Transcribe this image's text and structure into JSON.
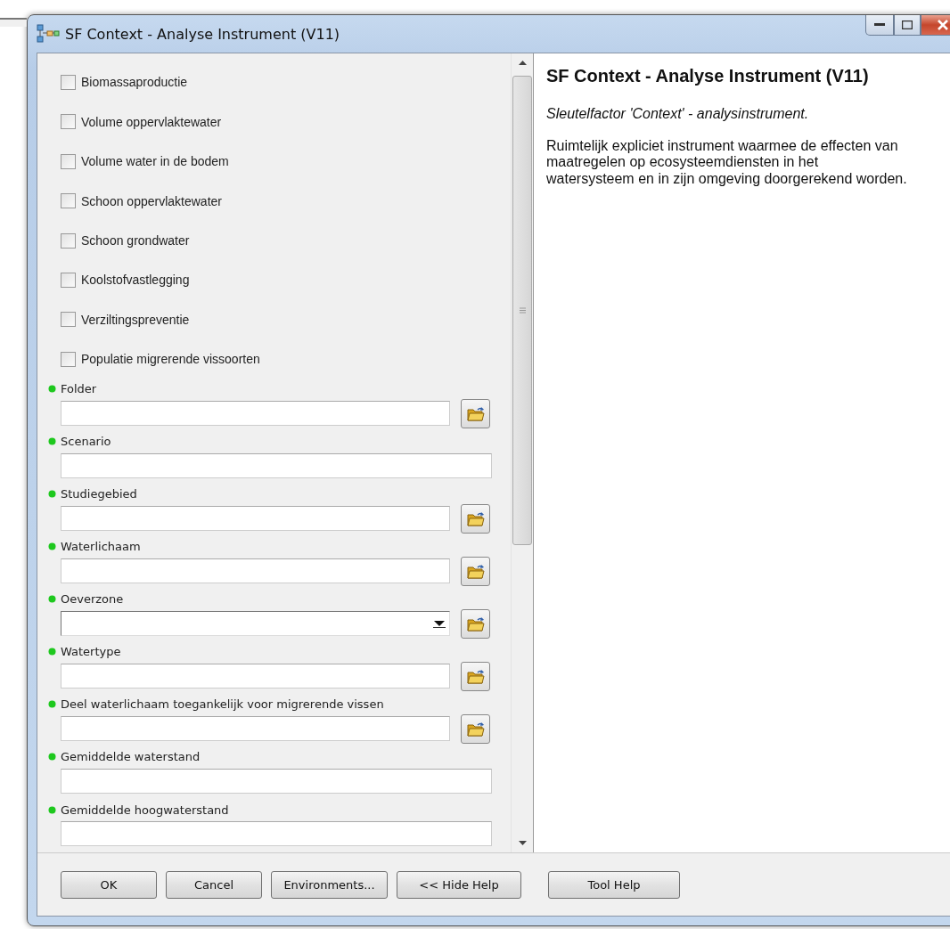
{
  "window": {
    "title": "SF Context - Analyse Instrument (V11)"
  },
  "parameters": [
    {
      "kind": "checkbox",
      "label": "Biomassaproductie",
      "checked": false
    },
    {
      "kind": "checkbox",
      "label": "Volume oppervlaktewater",
      "checked": false
    },
    {
      "kind": "checkbox",
      "label": "Volume water in de bodem",
      "checked": false
    },
    {
      "kind": "checkbox",
      "label": "Schoon oppervlaktewater",
      "checked": false
    },
    {
      "kind": "checkbox",
      "label": "Schoon grondwater",
      "checked": false
    },
    {
      "kind": "checkbox",
      "label": "Koolstofvastlegging",
      "checked": false
    },
    {
      "kind": "checkbox",
      "label": "Verziltingspreventie",
      "checked": false
    },
    {
      "kind": "checkbox",
      "label": "Populatie migrerende vissoorten",
      "checked": false
    },
    {
      "kind": "text",
      "label": "Folder",
      "browse": true
    },
    {
      "kind": "text",
      "label": "Scenario",
      "browse": false
    },
    {
      "kind": "text",
      "label": "Studiegebied",
      "browse": true
    },
    {
      "kind": "text",
      "label": "Waterlichaam",
      "browse": true
    },
    {
      "kind": "combo",
      "label": "Oeverzone",
      "browse": true
    },
    {
      "kind": "text",
      "label": "Watertype",
      "browse": true
    },
    {
      "kind": "text",
      "label": "Deel waterlichaam toegankelijk voor migrerende vissen",
      "browse": true
    },
    {
      "kind": "text",
      "label": "Gemiddelde waterstand",
      "browse": false
    },
    {
      "kind": "text",
      "label": "Gemiddelde hoogwaterstand",
      "browse": false
    }
  ],
  "help": {
    "title": "SF Context - Analyse Instrument (V11)",
    "summary": "Sleutelfactor 'Context' - analysinstrument.",
    "description": "Ruimtelijk expliciet instrument waarmee de effecten van maatregelen op ecosysteemdiensten in het watersysteem en in zijn omgeving doorgerekend worden."
  },
  "buttons": [
    "OK",
    "Cancel",
    "Environments...",
    "<< Hide Help"
  ],
  "help_button": "Tool Help"
}
